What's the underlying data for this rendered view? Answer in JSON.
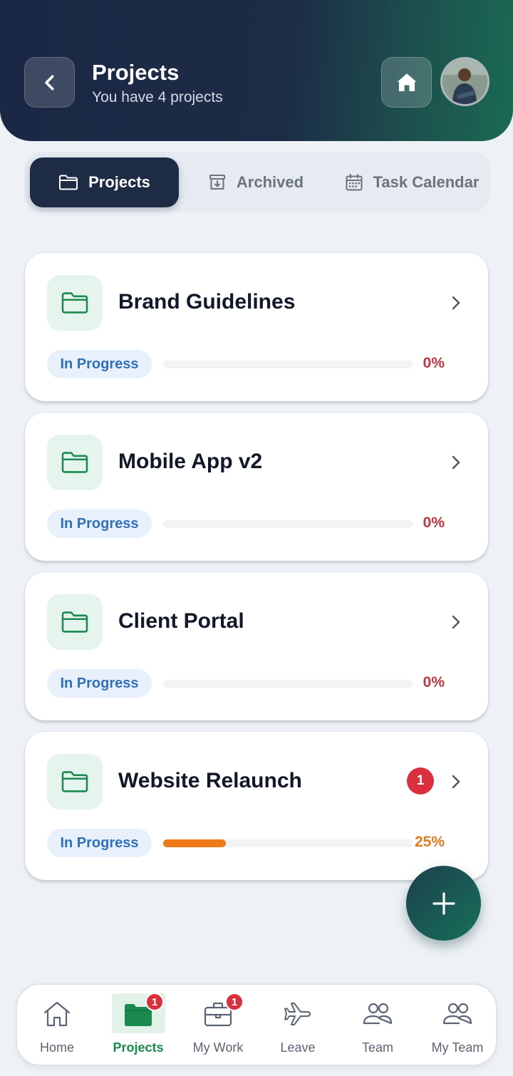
{
  "header": {
    "title": "Projects",
    "subtitle": "You have 4 projects"
  },
  "tabs": [
    {
      "label": "Projects",
      "icon": "folder-icon",
      "active": true
    },
    {
      "label": "Archived",
      "icon": "archive-icon",
      "active": false
    },
    {
      "label": "Task Calendar",
      "icon": "calendar-icon",
      "active": false
    }
  ],
  "projects": [
    {
      "name": "Brand Guidelines",
      "status": "In Progress",
      "progress_percent": 0,
      "progress_label": "0%",
      "badge": null
    },
    {
      "name": "Mobile App v2",
      "status": "In Progress",
      "progress_percent": 0,
      "progress_label": "0%",
      "badge": null
    },
    {
      "name": "Client Portal",
      "status": "In Progress",
      "progress_percent": 0,
      "progress_label": "0%",
      "badge": null
    },
    {
      "name": "Website Relaunch",
      "status": "In Progress",
      "progress_percent": 25,
      "progress_label": "25%",
      "badge": "1"
    }
  ],
  "fab": {
    "icon": "plus-icon"
  },
  "bottom_nav": [
    {
      "label": "Home",
      "icon": "home-icon",
      "active": false,
      "badge": null
    },
    {
      "label": "Projects",
      "icon": "folder-icon",
      "active": true,
      "badge": "1"
    },
    {
      "label": "My Work",
      "icon": "briefcase-icon",
      "active": false,
      "badge": "1"
    },
    {
      "label": "Leave",
      "icon": "airplane-icon",
      "active": false,
      "badge": null
    },
    {
      "label": "Team",
      "icon": "users-icon",
      "active": false,
      "badge": null
    },
    {
      "label": "My Team",
      "icon": "users-icon",
      "active": false,
      "badge": null
    }
  ],
  "colors": {
    "header_dark": "#1b2845",
    "header_accent": "#1a6a53",
    "active_tab": "#1d2b45",
    "brand_green": "#1a8a4e",
    "status_blue": "#2f6fc0",
    "zero_percent_red": "#c6343f",
    "progress_orange": "#f07a1a",
    "badge_red": "#dc2f3d"
  }
}
